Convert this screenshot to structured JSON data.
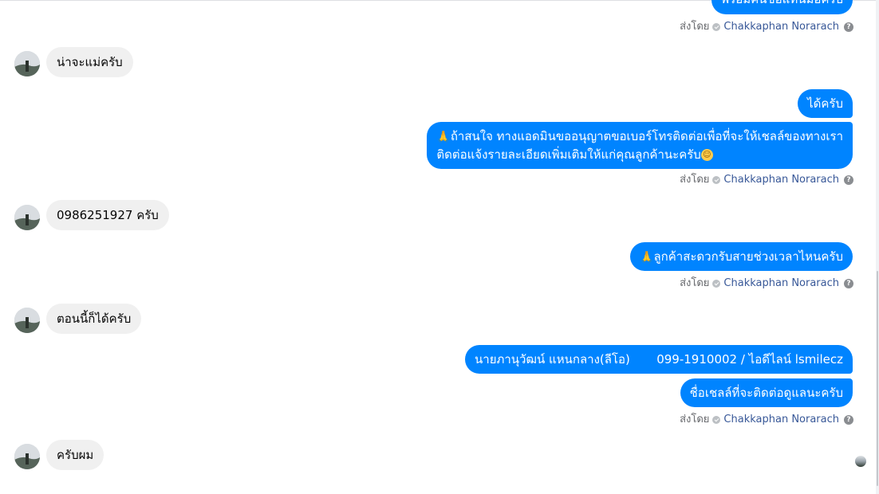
{
  "messages": {
    "out_cut": "พร้อมคันข้อแทนมือครับ",
    "in_1": "น่าจะแม่ครับ",
    "out_2": "ได้ครับ",
    "out_3_line1": "ถ้าสนใจ ทางแอดมินขออนุญาตขอเบอร์โทรติดต่อเพื่อที่จะให้เชลล์ของทางเรา",
    "out_3_line2": "ติดต่อแจ้งรายละเอียดเพิ่มเติมให้แก่คุณลูกค้านะครับ",
    "in_2": "0986251927 ครับ",
    "out_4": "ลูกค้าสะดวกรับสายช่วงเวลาไหนครับ",
    "in_3": "ตอนนี้ก็ได้ครับ",
    "out_5": "นายภานุวัฒน์ แหนกลาง(ลีโอ)       099-1910002 / ไอดีไลน์ lsmilecz",
    "out_6": "ชื่อเชลล์ที่จะติดต่อดูแลนะครับ",
    "in_4": "ครับผม"
  },
  "sent_by": {
    "label": "ส่งโดย",
    "name": "Chakkaphan Norarach",
    "help": "?"
  },
  "icons": {
    "pray": "🙏",
    "smile": "☺"
  }
}
